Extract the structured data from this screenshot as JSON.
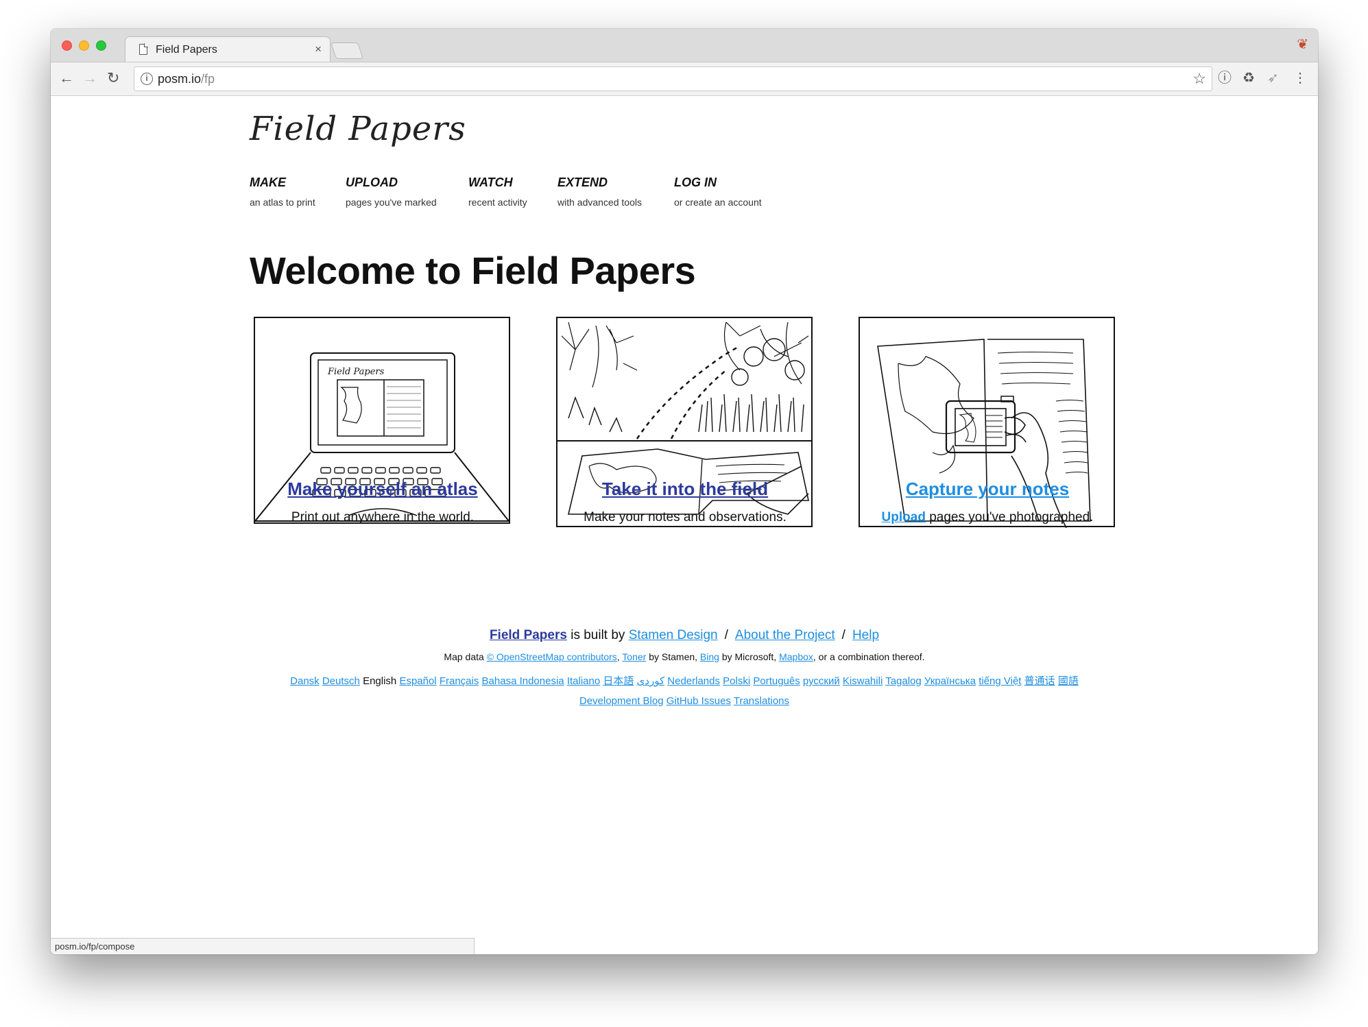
{
  "browser": {
    "tab_title": "Field Papers",
    "tab_close": "×",
    "url_host": "posm.io",
    "url_path": "/fp",
    "status_url": "posm.io/fp/compose"
  },
  "site": {
    "logo": "Field Papers",
    "nav": [
      {
        "title": "MAKE",
        "sub": "an atlas to print"
      },
      {
        "title": "UPLOAD",
        "sub": "pages you've marked"
      },
      {
        "title": "WATCH",
        "sub": "recent activity"
      },
      {
        "title": "EXTEND",
        "sub": "with advanced tools"
      },
      {
        "title": "LOG IN",
        "sub": "or create an account"
      }
    ],
    "heading": "Welcome to Field Papers",
    "cards": [
      {
        "link": "Make yourself an atlas",
        "text": "Print out anywhere in the world."
      },
      {
        "link": "Take it into the field",
        "text": "Make your notes and observations."
      },
      {
        "link": "Capture your notes",
        "text_link": "Upload",
        "text_rest": " pages you've photographed."
      }
    ],
    "footer": {
      "fp_link": "Field Papers",
      "built_by": " is built by ",
      "stamen": "Stamen Design",
      "slash": "/",
      "about": "About the Project",
      "help": "Help",
      "map_data_prefix": "Map data ",
      "osm": "© OpenStreetMap contributors",
      "comma": ", ",
      "toner": "Toner",
      "by_stamen": " by Stamen, ",
      "bing": "Bing",
      "by_ms": " by Microsoft, ",
      "mapbox": "Mapbox",
      "suffix": ", or a combination thereof.",
      "current_language": "English",
      "languages_before": [
        "Dansk",
        "Deutsch"
      ],
      "languages_after": [
        "Español",
        "Français",
        "Bahasa Indonesia",
        "Italiano",
        "日本語",
        "کوردی",
        "Nederlands",
        "Polski",
        "Português",
        "русский",
        "Kiswahili",
        "Tagalog",
        "Українська",
        "tiếng Việt",
        "普通话",
        "國語"
      ],
      "dev_links": [
        "Development Blog",
        "GitHub Issues",
        "Translations"
      ]
    }
  },
  "colors": {
    "dark_link": "#2c3a9e",
    "light_link": "#1e8ee0"
  }
}
